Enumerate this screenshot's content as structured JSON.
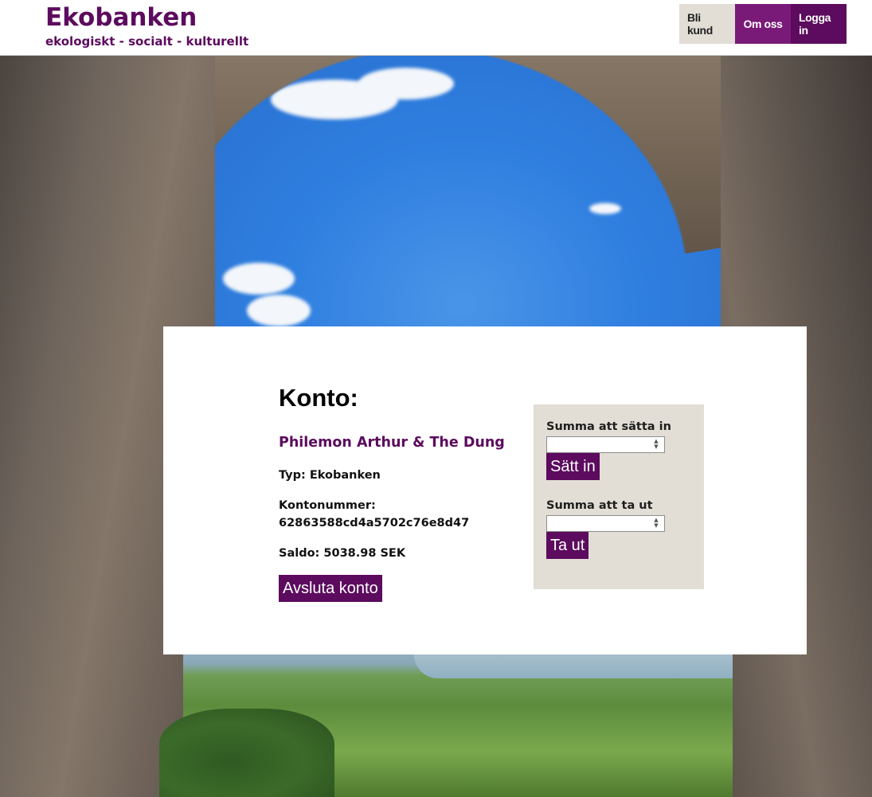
{
  "header": {
    "title": "Ekobanken",
    "tagline": "ekologiskt - socialt - kulturellt",
    "nav": {
      "become_customer": "Bli kund",
      "about": "Om oss",
      "login": "Logga in"
    }
  },
  "account": {
    "heading": "Konto:",
    "holder": "Philemon Arthur & The Dung",
    "type_label": "Typ: Ekobanken",
    "number_label": "Kontonummer:",
    "number": "62863588cd4a5702c76e8d47",
    "balance_label": "Saldo: 5038.98 SEK",
    "close_button": "Avsluta konto"
  },
  "transactions": {
    "deposit": {
      "label": "Summa att sätta in",
      "value": "",
      "button": "Sätt in"
    },
    "withdraw": {
      "label": "Summa att ta ut",
      "value": "",
      "button": "Ta ut"
    }
  },
  "colors": {
    "brand": "#5c0b5e",
    "accent": "#7a1a78",
    "panel": "#e2ded6"
  }
}
